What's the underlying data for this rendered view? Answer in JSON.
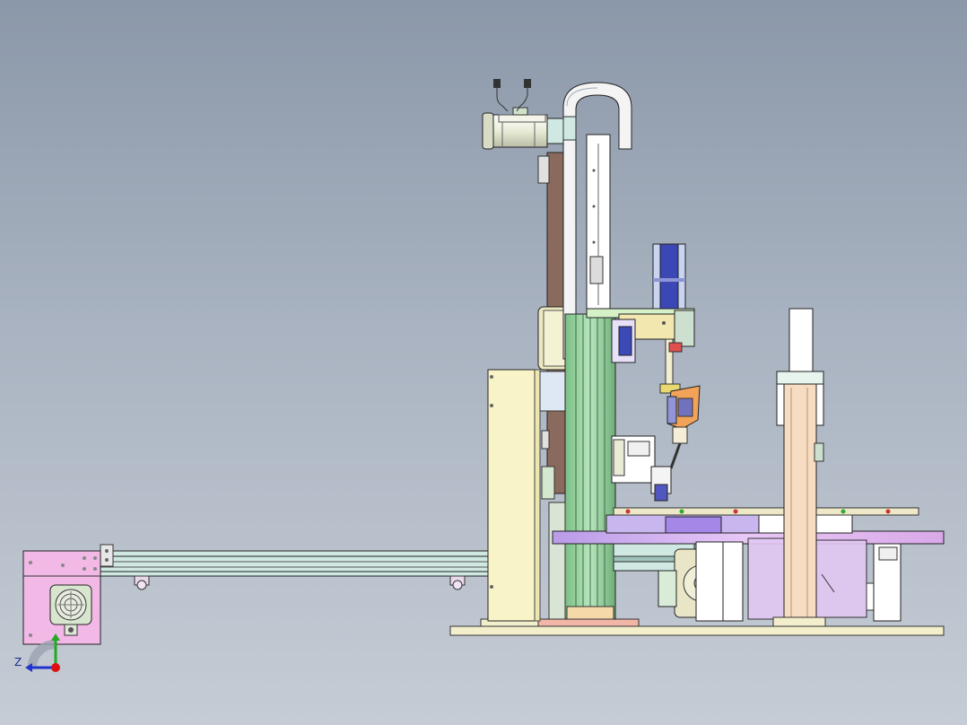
{
  "viewport": {
    "background_top": "#8b98a9",
    "background_bottom": "#c6ccd5"
  },
  "triad": {
    "axis_label": "Z",
    "label_color": "#1a2a8a",
    "y_axis_color": "#22aa22",
    "z_axis_color": "#2233cc",
    "x_axis_color": "#dd1111"
  },
  "parts": {
    "motor_color": "#e8ecd6",
    "rail_color": "#9fd6a4",
    "column_color": "#8b6a5e",
    "cabinet_color": "#f8f4c8",
    "turntable_color": "#d9a8e8",
    "base_plate_color": "#f3efcd",
    "gripper_color": "#f2a35a",
    "support_column_color": "#f6dcc0",
    "conveyor_color": "#cfe8e2",
    "drive_box_color": "#f2b8e6"
  }
}
